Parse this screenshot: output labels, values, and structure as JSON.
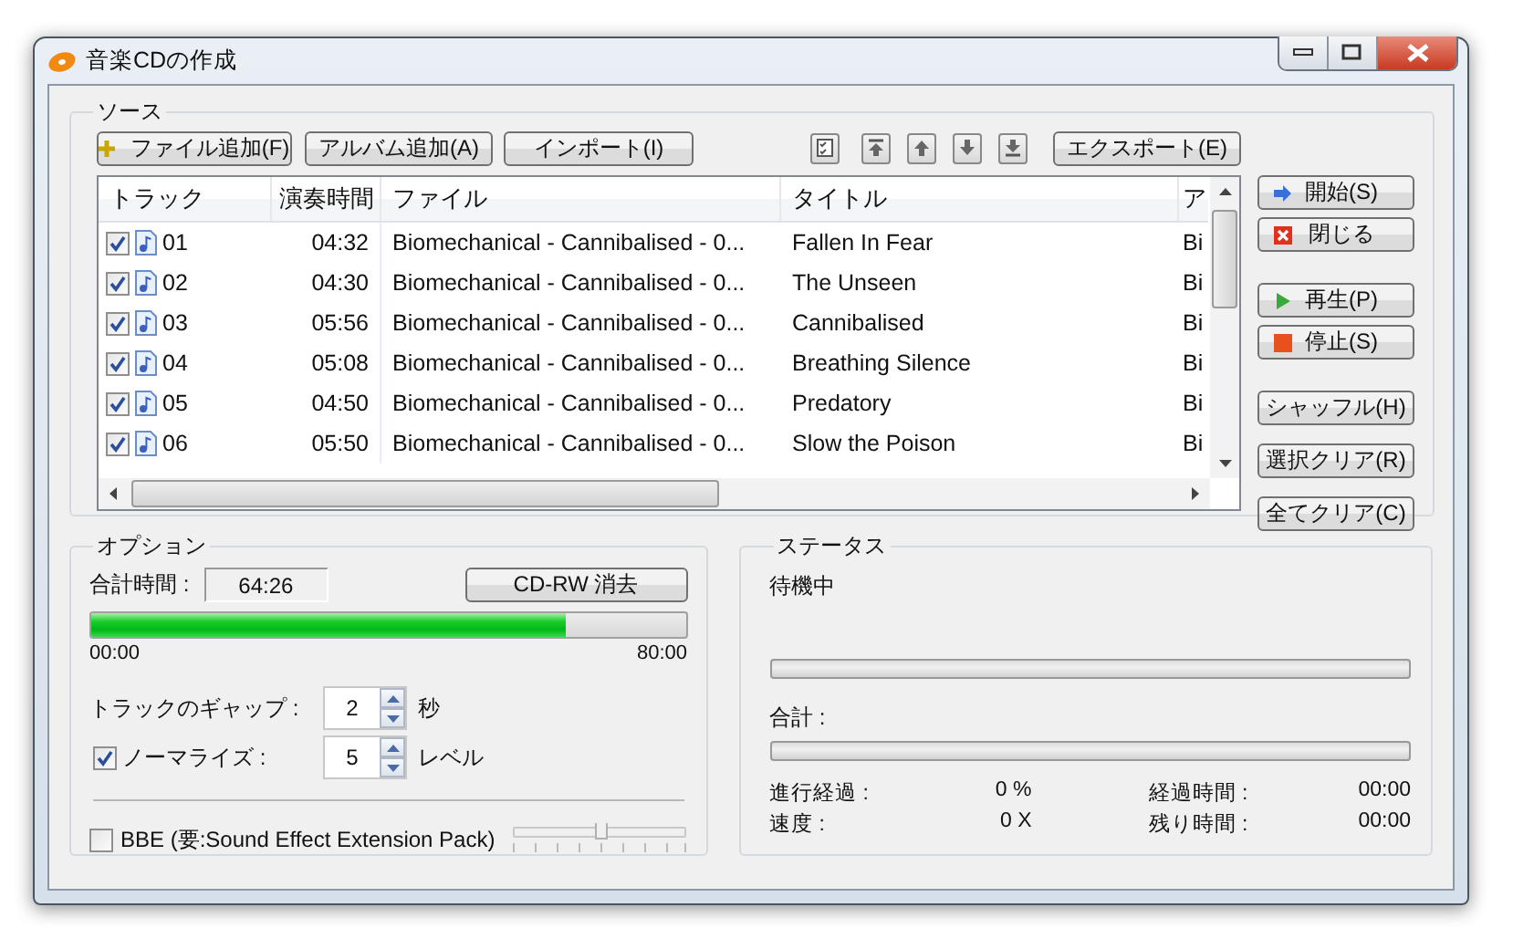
{
  "window": {
    "title": "音楽CDの作成"
  },
  "source": {
    "label": "ソース",
    "toolbar": [
      {
        "kind": "add",
        "label": "ファイル追加(F)"
      },
      {
        "kind": "text",
        "label": "アルバム追加(A)"
      },
      {
        "kind": "text",
        "label": "インポート(I)"
      }
    ],
    "export_button": "エクスポート(E)",
    "table": {
      "columns": [
        "トラック",
        "演奏時間",
        "ファイル",
        "タイトル",
        "ア"
      ],
      "rows": [
        {
          "checked": true,
          "track": "01",
          "duration": "04:32",
          "file": "Biomechanical - Cannibalised - 0...",
          "title": "Fallen In Fear",
          "column_5": "Bi"
        },
        {
          "checked": true,
          "track": "02",
          "duration": "04:30",
          "file": "Biomechanical - Cannibalised - 0...",
          "title": "The Unseen",
          "column_5": "Bi"
        },
        {
          "checked": true,
          "track": "03",
          "duration": "05:56",
          "file": "Biomechanical - Cannibalised - 0...",
          "title": "Cannibalised",
          "column_5": "Bi"
        },
        {
          "checked": true,
          "track": "04",
          "duration": "05:08",
          "file": "Biomechanical - Cannibalised - 0...",
          "title": "Breathing Silence",
          "column_5": "Bi"
        },
        {
          "checked": true,
          "track": "05",
          "duration": "04:50",
          "file": "Biomechanical - Cannibalised - 0...",
          "title": "Predatory",
          "column_5": "Bi"
        },
        {
          "checked": true,
          "track": "06",
          "duration": "05:50",
          "file": "Biomechanical - Cannibalised - 0...",
          "title": "Slow the Poison",
          "column_5": "Bi"
        }
      ]
    },
    "side_buttons": [
      {
        "kind": "start",
        "label": "開始(S)"
      },
      {
        "kind": "close",
        "label": "閉じる"
      },
      {
        "kind": "play",
        "label": "再生(P)"
      },
      {
        "kind": "stop",
        "label": "停止(S)"
      },
      {
        "kind": "plain",
        "label": "シャッフル(H)"
      },
      {
        "kind": "plain",
        "label": "選択クリア(R)"
      },
      {
        "kind": "plain",
        "label": "全てクリア(C)"
      }
    ]
  },
  "options": {
    "label": "オプション",
    "total_time_label": "合計時間 :",
    "total_time": "64:26",
    "erase_button": "CD-RW 消去",
    "capacity": {
      "level": 0.8,
      "start": "00:00",
      "end": "80:00"
    },
    "gap": {
      "label": "トラックのギャップ :",
      "value": "2",
      "unit": "秒"
    },
    "normalize": {
      "checked": true,
      "label": "ノーマライズ :",
      "value": "5",
      "unit": "レベル"
    },
    "bbe": {
      "checked": false,
      "label": "BBE (要:Sound Effect Extension Pack)",
      "level": 0.5
    }
  },
  "status": {
    "label": "ステータス",
    "state": "待機中",
    "current_progress": {
      "level": 0
    },
    "total_label": "合計 :",
    "total_progress": {
      "level": 0
    },
    "stats": [
      {
        "label": "進行経過 :",
        "value": "0 %"
      },
      {
        "label": "経過時間 :",
        "value": "00:00"
      },
      {
        "label": "速度 :",
        "value": "0 X"
      },
      {
        "label": "残り時間 :",
        "value": "00:00"
      }
    ]
  }
}
